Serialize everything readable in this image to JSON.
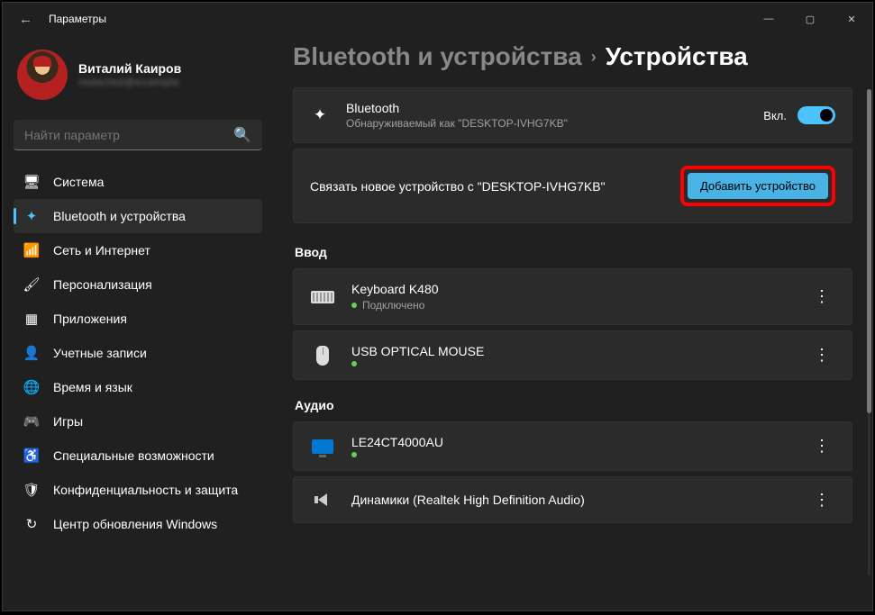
{
  "window": {
    "title": "Параметры"
  },
  "user": {
    "name": "Виталий Каиров",
    "email": "redacted@example"
  },
  "search": {
    "placeholder": "Найти параметр"
  },
  "nav": [
    {
      "id": "system",
      "label": "Система",
      "active": false
    },
    {
      "id": "bluetooth",
      "label": "Bluetooth и устройства",
      "active": true
    },
    {
      "id": "network",
      "label": "Сеть и Интернет",
      "active": false
    },
    {
      "id": "personalization",
      "label": "Персонализация",
      "active": false
    },
    {
      "id": "apps",
      "label": "Приложения",
      "active": false
    },
    {
      "id": "accounts",
      "label": "Учетные записи",
      "active": false
    },
    {
      "id": "time",
      "label": "Время и язык",
      "active": false
    },
    {
      "id": "gaming",
      "label": "Игры",
      "active": false
    },
    {
      "id": "accessibility",
      "label": "Специальные возможности",
      "active": false
    },
    {
      "id": "privacy",
      "label": "Конфиденциальность и защита",
      "active": false
    },
    {
      "id": "update",
      "label": "Центр обновления Windows",
      "active": false
    }
  ],
  "breadcrumb": {
    "parent": "Bluetooth и устройства",
    "current": "Устройства"
  },
  "bluetooth_card": {
    "title": "Bluetooth",
    "subtitle": "Обнаруживаемый как \"DESKTOP-IVHG7KB\"",
    "state_label": "Вкл."
  },
  "pair_card": {
    "label": "Связать новое устройство с \"DESKTOP-IVHG7KB\"",
    "button": "Добавить устройство"
  },
  "sections": {
    "input": {
      "title": "Ввод",
      "devices": [
        {
          "name": "Keyboard K480",
          "status": "Подключено",
          "icon": "keyboard"
        },
        {
          "name": "USB OPTICAL MOUSE",
          "status": "",
          "icon": "mouse"
        }
      ]
    },
    "audio": {
      "title": "Аудио",
      "devices": [
        {
          "name": "LE24CT4000AU",
          "status": "",
          "icon": "monitor"
        },
        {
          "name": "Динамики (Realtek High Definition Audio)",
          "status": "",
          "icon": "speaker"
        }
      ]
    }
  }
}
